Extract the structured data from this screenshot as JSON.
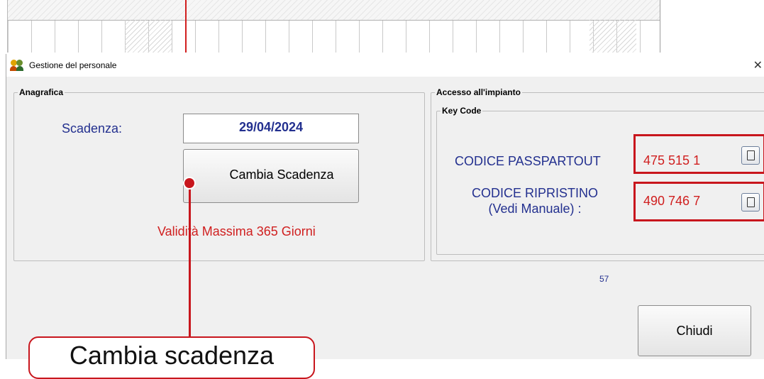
{
  "dialog": {
    "title": "Gestione del personale",
    "close_glyph": "✕"
  },
  "anagrafica": {
    "legend": "Anagrafica",
    "scadenza_label": "Scadenza:",
    "scadenza_value": "29/04/2024",
    "cambia_button": "Cambia Scadenza",
    "validita_text": "Validità Massima 365 Giorni"
  },
  "accesso": {
    "legend": "Accesso all'impianto",
    "keycode_legend": "Key Code",
    "passpartout_label": "CODICE PASSPARTOUT",
    "passpartout_value": "475 515 1",
    "ripristino_label_line1": "CODICE RIPRISTINO",
    "ripristino_label_line2": "(Vedi Manuale) :",
    "ripristino_value": "490 746 7"
  },
  "counter": "57",
  "chiudi_button": "Chiudi",
  "annotation": {
    "callout_text": "Cambia scadenza"
  },
  "icons": {
    "app": "users-icon",
    "copy": "copy-icon",
    "close": "close-icon"
  },
  "colors": {
    "label_blue": "#23308f",
    "code_red": "#d01f1f",
    "highlight_red": "#c8161d"
  }
}
